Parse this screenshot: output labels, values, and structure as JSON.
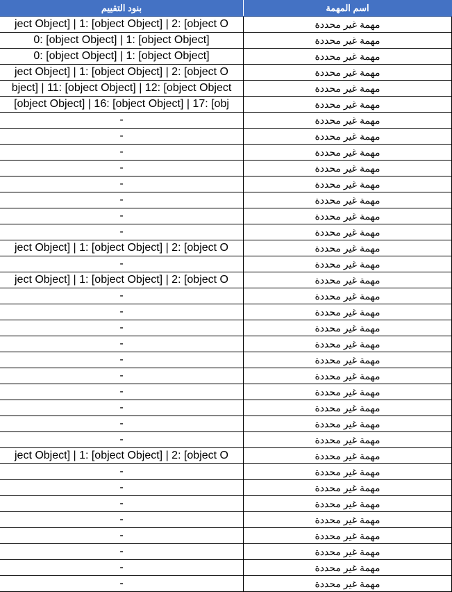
{
  "table": {
    "headers": {
      "criteria": "بنود التقييم",
      "task_name": "اسم المهمة"
    },
    "rows": [
      {
        "criteria": "ject Object] | 1: [object Object] | 2: [object O",
        "task_name": "مهمة غير محددة"
      },
      {
        "criteria": "0: [object Object] | 1: [object Object]",
        "task_name": "مهمة غير محددة"
      },
      {
        "criteria": "0: [object Object] | 1: [object Object]",
        "task_name": "مهمة غير محددة"
      },
      {
        "criteria": "ject Object] | 1: [object Object] | 2: [object O",
        "task_name": "مهمة غير محددة"
      },
      {
        "criteria": "bject] | 11: [object Object] | 12: [object Object",
        "task_name": "مهمة غير محددة"
      },
      {
        "criteria": "[object Object] | 16: [object Object] | 17: [obj",
        "task_name": "مهمة غير محددة"
      },
      {
        "criteria": "-",
        "task_name": "مهمة غير محددة"
      },
      {
        "criteria": "-",
        "task_name": "مهمة غير محددة"
      },
      {
        "criteria": "-",
        "task_name": "مهمة غير محددة"
      },
      {
        "criteria": "-",
        "task_name": "مهمة غير محددة"
      },
      {
        "criteria": "-",
        "task_name": "مهمة غير محددة"
      },
      {
        "criteria": "-",
        "task_name": "مهمة غير محددة"
      },
      {
        "criteria": "-",
        "task_name": "مهمة غير محددة"
      },
      {
        "criteria": "-",
        "task_name": "مهمة غير محددة"
      },
      {
        "criteria": "ject Object] | 1: [object Object] | 2: [object O",
        "task_name": "مهمة غير محددة"
      },
      {
        "criteria": "-",
        "task_name": "مهمة غير محددة"
      },
      {
        "criteria": "ject Object] | 1: [object Object] | 2: [object O",
        "task_name": "مهمة غير محددة"
      },
      {
        "criteria": "-",
        "task_name": "مهمة غير محددة"
      },
      {
        "criteria": "-",
        "task_name": "مهمة غير محددة"
      },
      {
        "criteria": "-",
        "task_name": "مهمة غير محددة"
      },
      {
        "criteria": "-",
        "task_name": "مهمة غير محددة"
      },
      {
        "criteria": "-",
        "task_name": "مهمة غير محددة"
      },
      {
        "criteria": "-",
        "task_name": "مهمة غير محددة"
      },
      {
        "criteria": "-",
        "task_name": "مهمة غير محددة"
      },
      {
        "criteria": "-",
        "task_name": "مهمة غير محددة"
      },
      {
        "criteria": "-",
        "task_name": "مهمة غير محددة"
      },
      {
        "criteria": "-",
        "task_name": "مهمة غير محددة"
      },
      {
        "criteria": "ject Object] | 1: [object Object] | 2: [object O",
        "task_name": "مهمة غير محددة"
      },
      {
        "criteria": "-",
        "task_name": "مهمة غير محددة"
      },
      {
        "criteria": "-",
        "task_name": "مهمة غير محددة"
      },
      {
        "criteria": "-",
        "task_name": "مهمة غير محددة"
      },
      {
        "criteria": "-",
        "task_name": "مهمة غير محددة"
      },
      {
        "criteria": "-",
        "task_name": "مهمة غير محددة"
      },
      {
        "criteria": "-",
        "task_name": "مهمة غير محددة"
      },
      {
        "criteria": "-",
        "task_name": "مهمة غير محددة"
      },
      {
        "criteria": "-",
        "task_name": "مهمة غير محددة"
      }
    ]
  },
  "colors": {
    "header_background": "#4472c4",
    "header_text": "#ffffff",
    "grid": "#000000"
  }
}
